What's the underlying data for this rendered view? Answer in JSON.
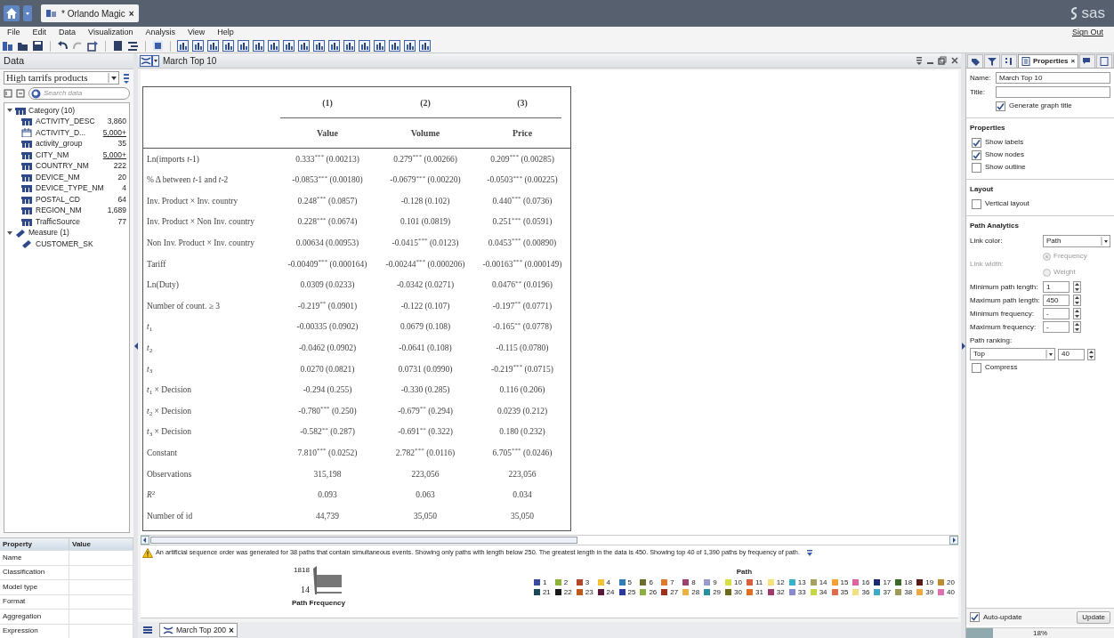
{
  "app_bar": {
    "tab_label": "* Orlando Magic",
    "tab_close": "×",
    "logo": "sas"
  },
  "menu": [
    "File",
    "Edit",
    "Data",
    "Visualization",
    "Analysis",
    "View",
    "Help"
  ],
  "sign_out": "Sign Out",
  "data_panel": {
    "title": "Data",
    "source": "High tarrifs products",
    "search_placeholder": "Search data",
    "tree": [
      {
        "label": "Category (10)",
        "kind": "category",
        "expanded": true,
        "children": [
          {
            "label": "ACTIVITY_DESC",
            "count": "3,860",
            "kind": "category",
            "underlined": false
          },
          {
            "label": "ACTIVITY_D...",
            "count": "5,000+",
            "kind": "date",
            "underlined": true
          },
          {
            "label": "activity_group",
            "count": "35",
            "kind": "category",
            "underlined": false
          },
          {
            "label": "CITY_NM",
            "count": "5,000+",
            "kind": "category",
            "underlined": true
          },
          {
            "label": "COUNTRY_NM",
            "count": "222",
            "kind": "category",
            "underlined": false
          },
          {
            "label": "DEVICE_NM",
            "count": "20",
            "kind": "category",
            "underlined": false
          },
          {
            "label": "DEVICE_TYPE_NM",
            "count": "4",
            "kind": "category",
            "underlined": false
          },
          {
            "label": "POSTAL_CD",
            "count": "64",
            "kind": "category",
            "underlined": false
          },
          {
            "label": "REGION_NM",
            "count": "1,689",
            "kind": "category",
            "underlined": false
          },
          {
            "label": "TrafficSource",
            "count": "77",
            "kind": "category",
            "underlined": false
          }
        ]
      },
      {
        "label": "Measure (1)",
        "kind": "measure",
        "expanded": true,
        "children": [
          {
            "label": "CUSTOMER_SK",
            "kind": "measure"
          }
        ]
      }
    ]
  },
  "property_table": {
    "columns": [
      "Property",
      "Value"
    ],
    "rows": [
      "Name",
      "Classification",
      "Model type",
      "Format",
      "Aggregation",
      "Expression"
    ]
  },
  "report": {
    "title": "March Top 10",
    "table": {
      "column_numbers": [
        "(1)",
        "(2)",
        "(3)"
      ],
      "columns": [
        "Value",
        "Volume",
        "Price"
      ],
      "rows": [
        {
          "label": "Ln(imports *t*-1)",
          "cells": [
            "0.333$^{***}$ (0.00213)",
            "0.279$^{***}$ (0.00266)",
            "0.209$^{***}$ (0.00285)"
          ]
        },
        {
          "label": "% Δ between *t*-1 and *t*-2",
          "cells": [
            "-0.0853$^{***}$ (0.00180)",
            "-0.0679$^{***}$ (0.00220)",
            "-0.0503$^{***}$ (0.00225)"
          ]
        },
        {
          "label": "Inv. Product × Inv. country",
          "cells": [
            "0.248$^{***}$ (0.0857)",
            "-0.128 (0.102)",
            "0.440$^{***}$ (0.0736)"
          ]
        },
        {
          "label": "Inv. Product × Non Inv. country",
          "cells": [
            "0.228$^{***}$ (0.0674)",
            "0.101 (0.0819)",
            "0.251$^{***}$ (0.0591)"
          ]
        },
        {
          "label": "Non Inv. Product × Inv. country",
          "cells": [
            "0.00634 (0.00953)",
            "-0.0415$^{***}$ (0.0123)",
            "0.0453$^{***}$ (0.00890)"
          ]
        },
        {
          "label": "Tariff",
          "cells": [
            "-0.00409$^{***}$ (0.000164)",
            "-0.00244$^{***}$ (0.000206)",
            "-0.00163$^{***}$ (0.000149)"
          ]
        },
        {
          "label": "Ln(Duty)",
          "cells": [
            "0.0309 (0.0233)",
            "-0.0342 (0.0271)",
            "0.0476$^{**}$ (0.0196)"
          ]
        },
        {
          "label": "Number of count. ≥ 3",
          "cells": [
            "-0.219$^{**}$ (0.0901)",
            "-0.122 (0.107)",
            "-0.197$^{**}$ (0.0771)"
          ]
        },
        {
          "label": "*t*$_{1}$",
          "cells": [
            "-0.00335 (0.0902)",
            "0.0679 (0.108)",
            "-0.165$^{**}$ (0.0778)"
          ]
        },
        {
          "label": "*t*$_{2}$",
          "cells": [
            "-0.0462 (0.0902)",
            "-0.0641 (0.108)",
            "-0.115 (0.0780)"
          ]
        },
        {
          "label": "*t*$_{3}$",
          "cells": [
            "0.0270 (0.0821)",
            "0.0731 (0.0990)",
            "-0.219$^{***}$ (0.0715)"
          ]
        },
        {
          "label": "*t*$_{1}$ × Decision",
          "cells": [
            "-0.294 (0.255)",
            "-0.330 (0.285)",
            "0.116 (0.206)"
          ]
        },
        {
          "label": "*t*$_{2}$ × Decision",
          "cells": [
            "-0.780$^{***}$ (0.250)",
            "-0.679$^{**}$ (0.294)",
            "0.0239 (0.212)"
          ]
        },
        {
          "label": "*t*$_{3}$ × Decision",
          "cells": [
            "-0.582$^{**}$ (0.287)",
            "-0.691$^{**}$ (0.322)",
            "0.180 (0.232)"
          ]
        },
        {
          "label": "Constant",
          "cells": [
            "7.810$^{***}$ (0.0252)",
            "2.782$^{***}$ (0.0116)",
            "6.705$^{***}$ (0.0246)"
          ]
        },
        {
          "label": "Observations",
          "cells": [
            "315,198",
            "223,056",
            "223,056"
          ]
        },
        {
          "label": "*R*$^{2}$",
          "cells": [
            "0.093",
            "0.063",
            "0.034"
          ]
        },
        {
          "label": "Number of id",
          "cells": [
            "44,739",
            "35,050",
            "35,050"
          ]
        }
      ]
    },
    "notice": "An artificial sequence order was generated for 38 paths that contain simultaneous events. Showing only paths with length below 250.  The greatest length in the data is 450.  Showing top 40 of 1,390 paths by frequency of path.",
    "frequency_legend": {
      "max": "1818",
      "min": "14",
      "title": "Path Frequency"
    },
    "path_legend": {
      "title": "Path",
      "items": [
        {
          "label": "1",
          "color": "#3b4ba0"
        },
        {
          "label": "2",
          "color": "#8db33a"
        },
        {
          "label": "3",
          "color": "#b5442a"
        },
        {
          "label": "4",
          "color": "#f2c230"
        },
        {
          "label": "5",
          "color": "#2f7fb5"
        },
        {
          "label": "6",
          "color": "#6d6d2a"
        },
        {
          "label": "7",
          "color": "#e07a2a"
        },
        {
          "label": "8",
          "color": "#a04070"
        },
        {
          "label": "9",
          "color": "#9a9acc"
        },
        {
          "label": "10",
          "color": "#d8e040"
        },
        {
          "label": "11",
          "color": "#d9603a"
        },
        {
          "label": "12",
          "color": "#f5e27a"
        },
        {
          "label": "13",
          "color": "#3ab0c8"
        },
        {
          "label": "14",
          "color": "#a8a060"
        },
        {
          "label": "15",
          "color": "#f5a030"
        },
        {
          "label": "16",
          "color": "#e060a0"
        },
        {
          "label": "17",
          "color": "#1a2a70"
        },
        {
          "label": "18",
          "color": "#3a6a2a"
        },
        {
          "label": "19",
          "color": "#5a1a1a"
        },
        {
          "label": "20",
          "color": "#c08a30"
        },
        {
          "label": "21",
          "color": "#1a4a5a"
        },
        {
          "label": "22",
          "color": "#1a1a1a"
        },
        {
          "label": "23",
          "color": "#c05a1a"
        },
        {
          "label": "24",
          "color": "#5a1a3a"
        },
        {
          "label": "25",
          "color": "#2a3aa0"
        },
        {
          "label": "26",
          "color": "#8ab040"
        },
        {
          "label": "27",
          "color": "#a0301a"
        },
        {
          "label": "28",
          "color": "#f0b040"
        },
        {
          "label": "29",
          "color": "#2a90a0"
        },
        {
          "label": "30",
          "color": "#6a6a1a"
        },
        {
          "label": "31",
          "color": "#e07020"
        },
        {
          "label": "32",
          "color": "#a03a6a"
        },
        {
          "label": "33",
          "color": "#8a8ad0"
        },
        {
          "label": "34",
          "color": "#c8d840"
        },
        {
          "label": "35",
          "color": "#e06a4a"
        },
        {
          "label": "36",
          "color": "#f0e080"
        },
        {
          "label": "37",
          "color": "#40a8c8"
        },
        {
          "label": "38",
          "color": "#a09a5a"
        },
        {
          "label": "39",
          "color": "#f0a840"
        },
        {
          "label": "40",
          "color": "#e070b0"
        }
      ]
    }
  },
  "bottom_tabs": [
    {
      "label": "March Top 200",
      "close": "×",
      "selected": true
    }
  ],
  "properties_panel": {
    "tabs": [
      {
        "kind": "tag",
        "selected": false
      },
      {
        "kind": "filter",
        "selected": false
      },
      {
        "kind": "ranks",
        "selected": false
      },
      {
        "kind": "text",
        "label": "Properties",
        "close": "×",
        "selected": true
      },
      {
        "kind": "comments",
        "selected": false
      },
      {
        "kind": "doc",
        "selected": false
      }
    ],
    "name_label": "Name:",
    "name_value": "March Top 10",
    "title_label": "Title:",
    "generate_title": {
      "label": "Generate graph title",
      "checked": true
    },
    "sections": [
      {
        "title": "Properties",
        "items": [
          {
            "kind": "checkbox",
            "label": "Show labels",
            "checked": true
          },
          {
            "kind": "checkbox",
            "label": "Show nodes",
            "checked": true
          },
          {
            "kind": "checkbox",
            "label": "Show outline",
            "checked": false
          }
        ]
      },
      {
        "title": "Layout",
        "items": [
          {
            "kind": "checkbox",
            "label": "Vertical layout",
            "checked": false
          }
        ]
      },
      {
        "title": "Path Analytics",
        "items": [
          {
            "kind": "select",
            "label": "Link color:",
            "value": "Path"
          },
          {
            "kind": "radio",
            "label": "Link width:",
            "disabled": true,
            "options": [
              {
                "label": "Frequency",
                "selected": true
              },
              {
                "label": "Weight",
                "selected": false
              }
            ]
          },
          {
            "kind": "spinner",
            "label": "Minimum path length:",
            "value": "1"
          },
          {
            "kind": "spinner",
            "label": "Maximum path length:",
            "value": "450"
          },
          {
            "kind": "spinner",
            "label": "Minimum frequency:",
            "value": "-"
          },
          {
            "kind": "spinner",
            "label": "Maximum frequency:",
            "value": "-"
          },
          {
            "kind": "ranking",
            "label": "Path ranking:",
            "value": "Top",
            "count": "40"
          },
          {
            "kind": "checkbox",
            "label": "Compress",
            "checked": false
          }
        ]
      }
    ],
    "auto_update": {
      "label": "Auto-update",
      "checked": true
    },
    "update_button": "Update",
    "progress": {
      "level": 0.18,
      "reading": "18%"
    }
  }
}
